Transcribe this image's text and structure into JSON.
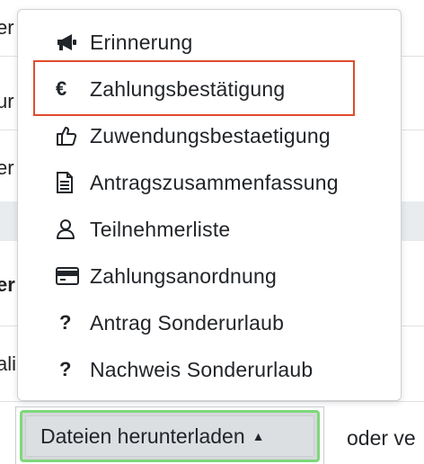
{
  "background": {
    "fragments": [
      "er",
      "ur",
      "er",
      "er",
      "ali"
    ]
  },
  "menu": {
    "items": [
      {
        "label": "Erinnerung",
        "icon": "megaphone-icon"
      },
      {
        "label": "Zahlungsbestätigung",
        "icon": "euro-icon",
        "glyph": "€"
      },
      {
        "label": "Zuwendungsbestaetigung",
        "icon": "thumbs-up-icon"
      },
      {
        "label": "Antragszusammenfassung",
        "icon": "document-icon"
      },
      {
        "label": "Teilnehmerliste",
        "icon": "user-icon"
      },
      {
        "label": "Zahlungsanordnung",
        "icon": "credit-card-icon"
      },
      {
        "label": "Antrag Sonderurlaub",
        "icon": "question-icon",
        "glyph": "?"
      },
      {
        "label": "Nachweis Sonderurlaub",
        "icon": "question-icon",
        "glyph": "?"
      }
    ],
    "highlighted_index": 1
  },
  "download_button": {
    "label": "Dateien herunterladen",
    "caret": "▲"
  },
  "trailing_text": "oder ve",
  "colors": {
    "highlight_border": "#e04b2c",
    "button_focus_border": "#7dd87a",
    "button_bg": "#dcdfe2"
  }
}
